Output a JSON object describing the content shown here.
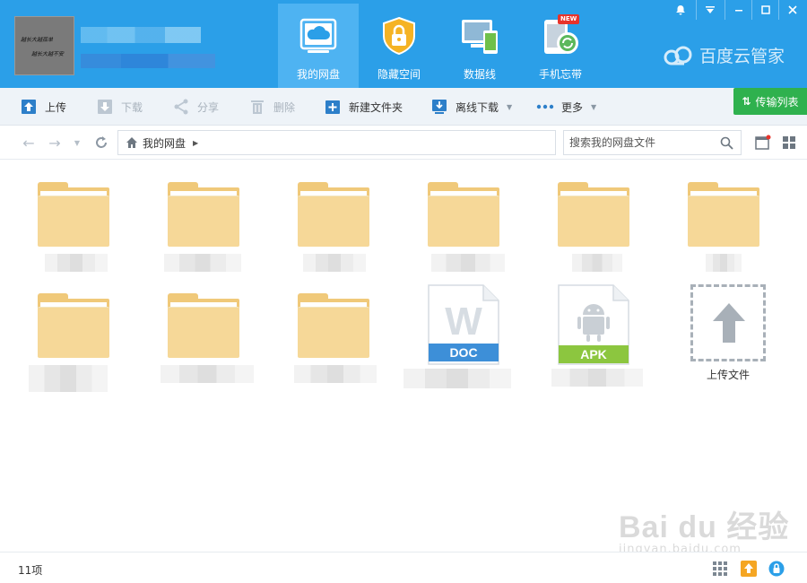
{
  "header": {
    "avatar_line1": "越长大越孤单",
    "avatar_line2": "越长大越不安",
    "tabs": [
      {
        "label": "我的网盘",
        "icon": "cloud-drive-icon",
        "active": true
      },
      {
        "label": "隐藏空间",
        "icon": "lock-shield-icon",
        "active": false
      },
      {
        "label": "数据线",
        "icon": "devices-icon",
        "active": false
      },
      {
        "label": "手机忘带",
        "icon": "phone-sync-icon",
        "active": false,
        "badge": "NEW"
      }
    ],
    "brand": "百度云管家"
  },
  "toolbar": {
    "upload": "上传",
    "download": "下载",
    "share": "分享",
    "delete": "删除",
    "new_folder": "新建文件夹",
    "offline_download": "离线下载",
    "more": "更多",
    "transfer_list": "传输列表"
  },
  "address": {
    "path": "我的网盘",
    "search_placeholder": "搜索我的网盘文件"
  },
  "files": {
    "doc_ext": "DOC",
    "apk_ext": "APK",
    "upload_label": "上传文件"
  },
  "status": {
    "count": "11项"
  },
  "watermark": {
    "line1": "Bai du 经验",
    "line2": "jingyan.baidu.com"
  },
  "colors": {
    "header_bg": "#2b9fe8",
    "active_tab": "#4eb3f2",
    "toolbar_bg": "#eef3f8",
    "transfer_green": "#2fb14e",
    "folder": "#f6d898",
    "doc_blue": "#3d8fd8",
    "apk_green": "#8cc63f"
  }
}
